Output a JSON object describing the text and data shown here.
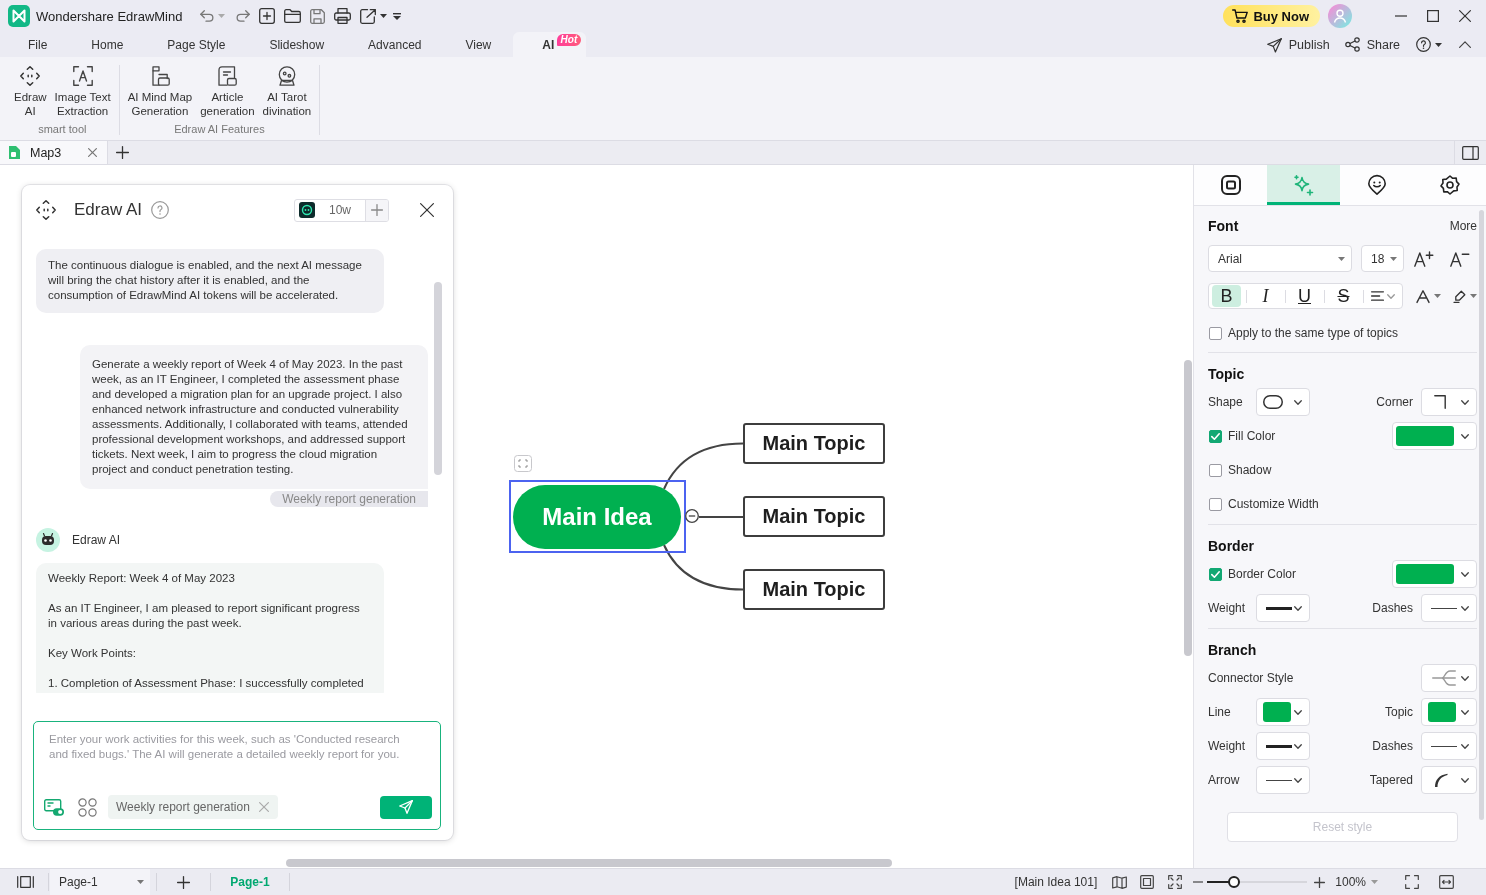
{
  "window": {
    "title": "Wondershare EdrawMind"
  },
  "title_bar": {
    "buy_button": "Buy Now"
  },
  "menu": {
    "tabs": [
      {
        "label": "File",
        "selected": false
      },
      {
        "label": "Home",
        "selected": false
      },
      {
        "label": "Page Style",
        "selected": false
      },
      {
        "label": "Slideshow",
        "selected": false
      },
      {
        "label": "Advanced",
        "selected": false
      },
      {
        "label": "View",
        "selected": false
      },
      {
        "label": "AI",
        "selected": true,
        "badge": "Hot"
      }
    ],
    "actions": [
      {
        "kind": "publish",
        "label": "Publish"
      },
      {
        "kind": "share",
        "label": "Share"
      }
    ]
  },
  "ribbon": {
    "groups": [
      {
        "label": "smart tool",
        "items": [
          {
            "kind": "assistant",
            "label": "Edraw\nAI"
          },
          {
            "kind": "ocr",
            "label": "Image Text\nExtraction"
          }
        ]
      },
      {
        "label": "Edraw AI Features",
        "items": [
          {
            "kind": "mindmap",
            "label": "AI Mind Map\nGeneration"
          },
          {
            "kind": "article",
            "label": "Article\ngeneration"
          },
          {
            "kind": "tarot",
            "label": "AI Tarot\ndivination"
          }
        ]
      }
    ]
  },
  "document_tabs": [
    {
      "label": "Map3",
      "selected": true
    }
  ],
  "ai_panel": {
    "title": "Edraw AI",
    "token_count": "10w",
    "messages": [
      {
        "kind": "notice",
        "text": "The continuous dialogue is enabled, and the next AI message will bring the chat history after it is enabled, and the consumption of EdrawMind AI tokens will be accelerated."
      },
      {
        "kind": "user",
        "text": "Generate a weekly report of Week 4 of May 2023. In the past week, as an IT Engineer, I completed the assessment phase and developed a migration plan for an upgrade project. I also enhanced network infrastructure and conducted vulnerability assessments. Additionally, I collaborated with teams, attended professional development workshops, and addressed support tickets. Next week, I aim to progress the cloud migration project and conduct penetration testing.",
        "tag": "Weekly report generation"
      },
      {
        "kind": "reply",
        "sender": "Edraw AI",
        "paragraphs": [
          "Weekly Report: Week 4 of May 2023",
          "As an IT Engineer, I am pleased to report significant progress in various areas during the past week.",
          "Key Work Points:",
          "1. Completion of Assessment Phase: I successfully completed"
        ]
      }
    ],
    "input": {
      "placeholder": "Enter your work activities for this week, such as 'Conducted research and fixed bugs.' The AI will generate a detailed weekly report for you.",
      "chip": "Weekly report generation"
    }
  },
  "mind_map": {
    "central": {
      "label": "Main Idea",
      "selected": true
    },
    "topics": [
      {
        "label": "Main Topic"
      },
      {
        "label": "Main Topic"
      },
      {
        "label": "Main Topic"
      }
    ]
  },
  "format_panel": {
    "tabs": [
      {
        "kind": "page",
        "selected": false
      },
      {
        "kind": "style",
        "selected": true
      },
      {
        "kind": "sticker",
        "selected": false
      },
      {
        "kind": "theme",
        "selected": false
      }
    ],
    "font": {
      "heading": "Font",
      "more": "More",
      "family": "Arial",
      "size": "18",
      "styles": [
        {
          "kind": "bold",
          "label": "B",
          "selected": true
        },
        {
          "kind": "italic",
          "label": "I",
          "selected": false
        },
        {
          "kind": "underline",
          "label": "U",
          "selected": false
        },
        {
          "kind": "strike",
          "label": "S",
          "selected": false
        },
        {
          "kind": "align",
          "selected": false
        }
      ],
      "apply_all": {
        "label": "Apply to the same type of topics",
        "checked": false
      }
    },
    "sections": [
      {
        "heading": "Topic",
        "rows": [
          {
            "kind": "pair",
            "items": [
              {
                "label": "Shape",
                "kind": "shape"
              },
              {
                "label": "Corner",
                "kind": "corner"
              }
            ]
          },
          {
            "kind": "check",
            "label": "Fill Color",
            "checked": true,
            "color": "#00b050"
          },
          {
            "kind": "check",
            "label": "Shadow",
            "checked": false
          },
          {
            "kind": "check",
            "label": "Customize Width",
            "checked": false
          }
        ]
      },
      {
        "heading": "Border",
        "rows": [
          {
            "kind": "check",
            "label": "Border Color",
            "checked": true,
            "color": "#00b050"
          },
          {
            "kind": "pair",
            "items": [
              {
                "label": "Weight",
                "kind": "thick"
              },
              {
                "label": "Dashes",
                "kind": "thin"
              }
            ]
          }
        ]
      },
      {
        "heading": "Branch",
        "rows": [
          {
            "kind": "single",
            "items": [
              {
                "label": "Connector Style",
                "kind": "connector"
              }
            ]
          },
          {
            "kind": "pair",
            "items": [
              {
                "label": "Line",
                "kind": "swatch",
                "color": "#00b050"
              },
              {
                "label": "Topic",
                "kind": "swatch",
                "color": "#00b050"
              }
            ]
          },
          {
            "kind": "pair",
            "items": [
              {
                "label": "Weight",
                "kind": "thick"
              },
              {
                "label": "Dashes",
                "kind": "thin"
              }
            ]
          },
          {
            "kind": "pair",
            "items": [
              {
                "label": "Arrow",
                "kind": "thin"
              },
              {
                "label": "Tapered",
                "kind": "tapered"
              }
            ]
          }
        ]
      }
    ],
    "reset_button": {
      "label": "Reset style",
      "disabled": true
    }
  },
  "status_bar": {
    "page_select": "Page-1",
    "pages": [
      {
        "label": "Page-1",
        "selected": true
      }
    ],
    "selection": "[Main Idea 101]",
    "zoom": {
      "level": 0.27,
      "reading": "100%"
    }
  }
}
